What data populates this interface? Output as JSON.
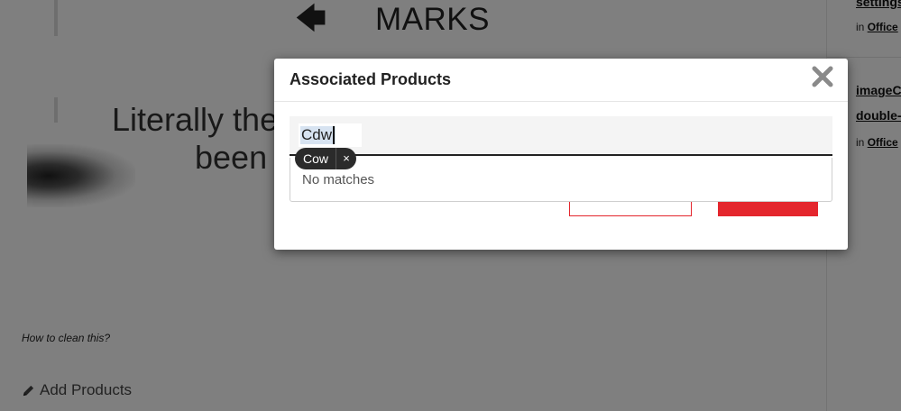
{
  "background": {
    "heading": "MARKS",
    "line1": "Literally the",
    "line2": "been",
    "caption": "How to clean this?",
    "add_products_label": "Add Products",
    "icons": {
      "back": "arrow-left-icon",
      "edit": "pencil-icon"
    }
  },
  "sidebar": {
    "items": [
      {
        "title": "settings",
        "in_label": "in",
        "category": "Office"
      },
      {
        "title_line1": "imageC",
        "title_line2": "double-",
        "in_label": "in",
        "category": "Office"
      }
    ]
  },
  "modal": {
    "title": "Associated Products",
    "close_icon": "close-icon",
    "search": {
      "value": "Cdw"
    },
    "tag": {
      "label": "Cow",
      "remove_glyph": "×"
    },
    "dropdown": {
      "no_matches": "No matches"
    },
    "colors": {
      "accent": "#e4262d",
      "overlay": "rgba(0,0,0,0.5)"
    }
  }
}
